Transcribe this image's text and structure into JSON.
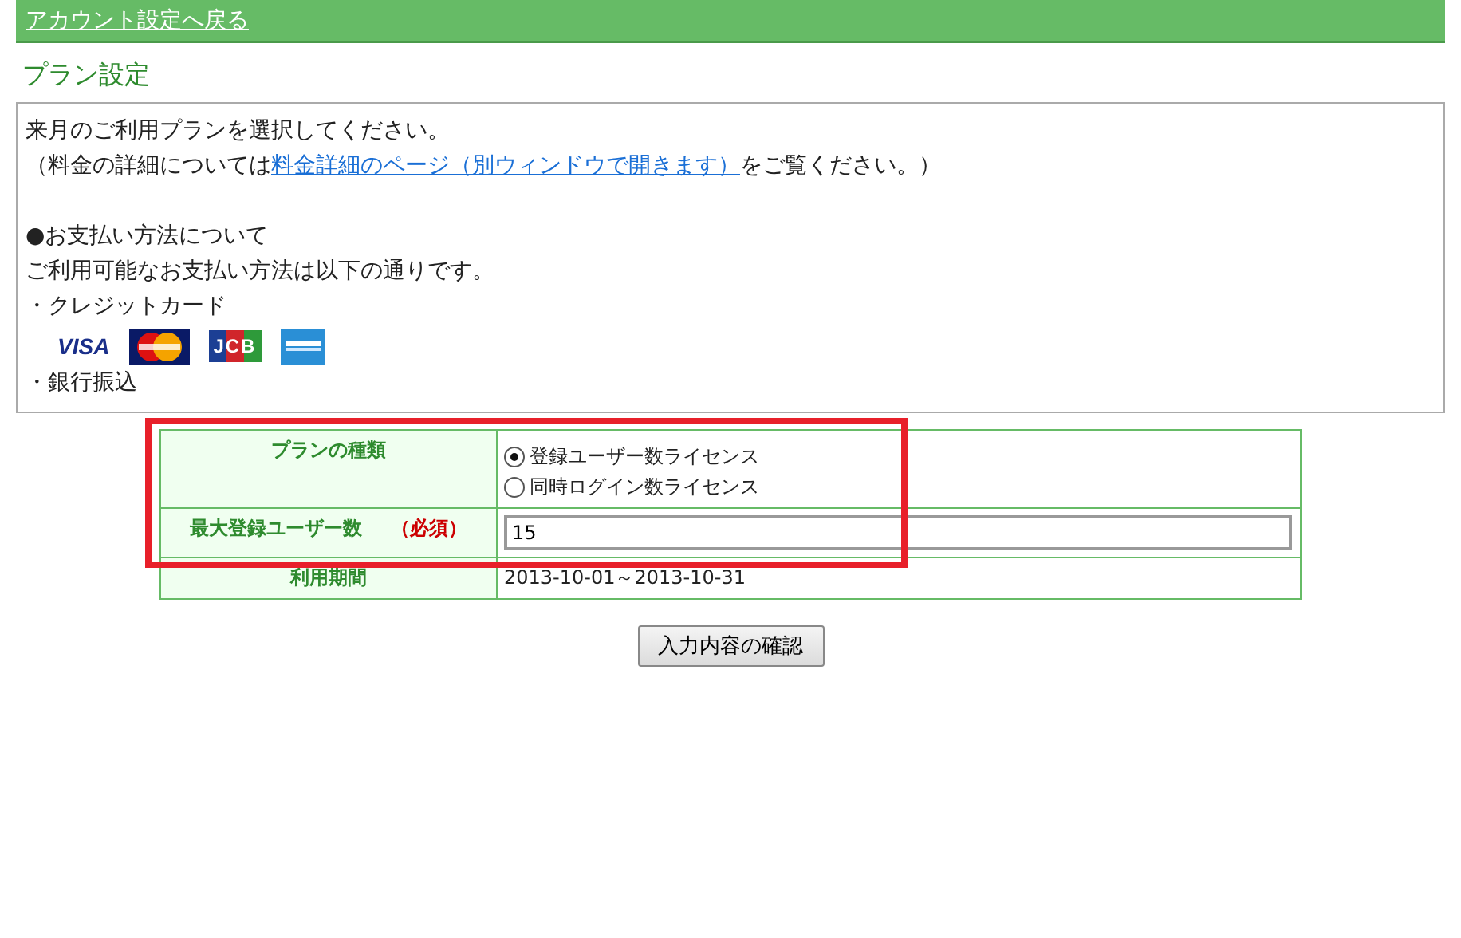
{
  "back_link": "アカウント設定へ戻る",
  "heading": "プラン設定",
  "info": {
    "line_1": "来月のご利用プランを選択してください。",
    "line_2_before": "（料金の詳細については",
    "line_2_link": "料金詳細のページ（別ウィンドウで開きます）",
    "line_2_after": "をご覧ください。）",
    "payment_heading": "●お支払い方法について",
    "payment_intro": "ご利用可能なお支払い方法は以下の通りです。",
    "credit_card": "・クレジットカード",
    "card_logos": [
      {
        "kind": "visa",
        "text": "VISA"
      },
      {
        "kind": "mastercard"
      },
      {
        "kind": "jcb",
        "text": "JCB"
      },
      {
        "kind": "amex"
      }
    ],
    "bank_transfer": "・銀行振込"
  },
  "form": {
    "rows": [
      {
        "kind": "radio",
        "label": "プランの種類",
        "options": [
          {
            "label": "登録ユーザー数ライセンス",
            "selected": true
          },
          {
            "label": "同時ログイン数ライセンス",
            "selected": false
          }
        ]
      },
      {
        "kind": "input",
        "label": "最大登録ユーザー数",
        "required": "（必須）",
        "value": "15"
      },
      {
        "kind": "text",
        "label": "利用期間",
        "value": "2013-10-01～2013-10-31"
      }
    ]
  },
  "confirm_button": "入力内容の確認"
}
